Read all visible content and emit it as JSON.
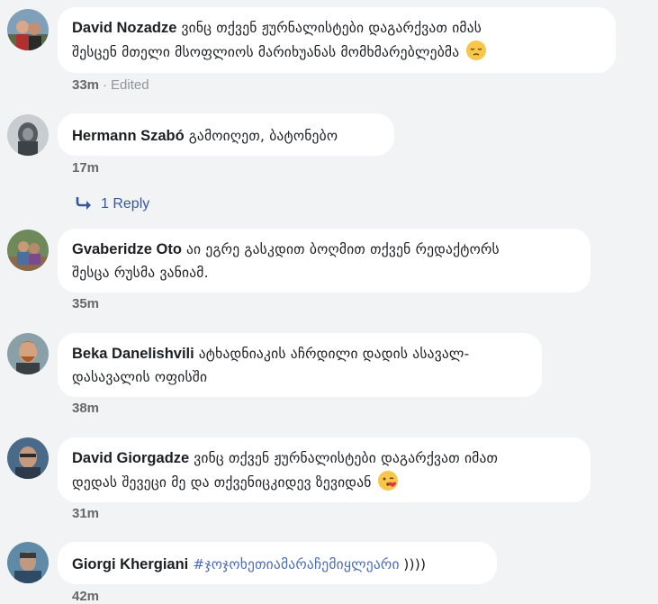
{
  "comments": [
    {
      "author": "David Nozadze",
      "text_line1": "ვინც თქვენ ჟურნალისტები დაგარქვათ იმას",
      "text_line2": "შესცენ მთელი მსოფლიოს მარიხუანას მომხმარებლებმა",
      "emoji": "pensive-face-icon",
      "time": "33m",
      "edited": "Edited"
    },
    {
      "author": "Hermann Szabó",
      "text_line1": "გამოიღეთ, ბატონებო",
      "time": "17m"
    },
    {
      "author": "Gvaberidze Oto",
      "text_line1": "აი ეგრე გასკდით ბოღმით თქვენ რედაქტორს",
      "text_line2": "შესცა რუსმა ვანიამ.",
      "time": "35m"
    },
    {
      "author": "Beka Danelishvili",
      "text_line1": "ატხადნიაკის აჩრდილი დადის ასავალ-",
      "text_line2": "დასავალის ოფისში",
      "time": "38m"
    },
    {
      "author": "David Giorgadze",
      "text_line1": "ვინც თქვენ ჟურნალისტები დაგარქვათ იმათ",
      "text_line2": "დედას შევეცი მე და თქვენიცკიდევ ზევიდან",
      "emoji": "kissing-face-icon",
      "time": "31m"
    },
    {
      "author": "Giorgi Khergiani",
      "hashtag": "#ჯოჯოხეთიამარაჩემიყლეარი",
      "text_line1": "))))",
      "time": "42m"
    }
  ],
  "reply_link": {
    "label": "1 Reply"
  },
  "colors": {
    "background": "#f2f3f5",
    "bubble": "#ffffff",
    "link": "#385898",
    "meta": "#65676b"
  }
}
